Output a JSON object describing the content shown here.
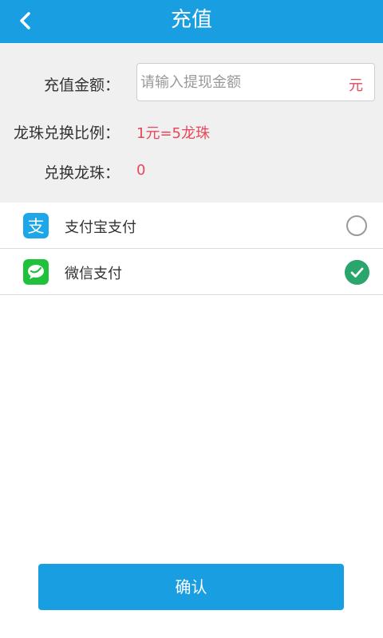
{
  "header": {
    "title": "充值"
  },
  "form": {
    "amount_label": "充值金额：",
    "amount_placeholder": "请输入提现金额",
    "amount_value": "",
    "amount_unit": "元",
    "ratio_label": "龙珠兑换比例：",
    "ratio_value": "1元=5龙珠",
    "beads_label": "兑换龙珠：",
    "beads_value": "0"
  },
  "payment_methods": [
    {
      "label": "支付宝支付",
      "icon": "alipay-icon",
      "selected": false
    },
    {
      "label": "微信支付",
      "icon": "wechat-pay-icon",
      "selected": true
    }
  ],
  "confirm_label": "确认",
  "colors": {
    "primary": "#1a9ee2",
    "accent_red": "#e8465a",
    "check_green": "#2aa66d",
    "wechat_green": "#1fc23a",
    "alipay_blue": "#1da7e8"
  }
}
